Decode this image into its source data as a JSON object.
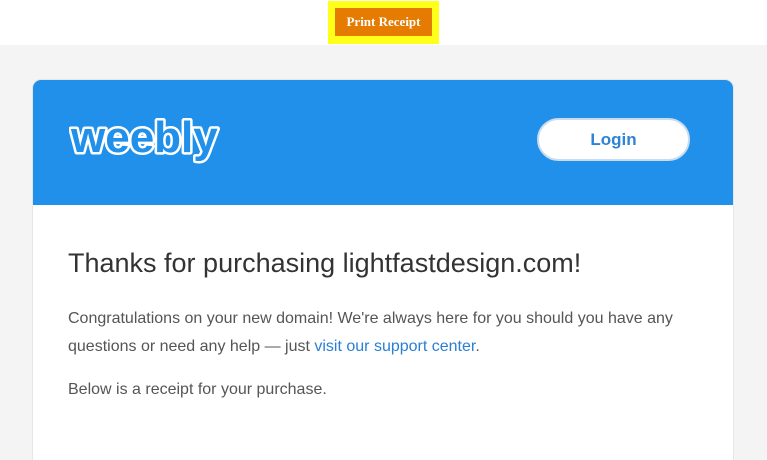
{
  "toolbar": {
    "print_label": "Print Receipt"
  },
  "header": {
    "logo_text": "weebly",
    "login_label": "Login"
  },
  "content": {
    "heading": "Thanks for purchasing lightfastdesign.com!",
    "congrats_text": "Congratulations on your new domain! We're always here for you should you have any questions or need any help — just ",
    "support_link": "visit our support center",
    "congrats_end": ".",
    "receipt_intro": "Below is a receipt for your purchase."
  },
  "colors": {
    "header_blue": "#2190ea",
    "print_button": "#e57b00",
    "highlight": "#ffff1a",
    "link": "#2a7fd4"
  }
}
